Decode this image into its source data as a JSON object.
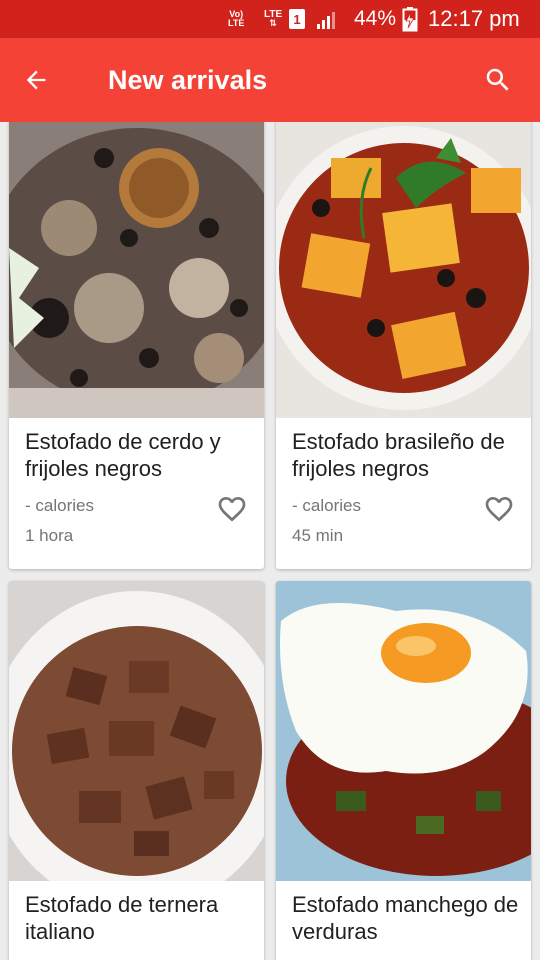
{
  "status_bar": {
    "volte_top": "Vo)",
    "volte_bottom": "LTE",
    "lte": "LTE",
    "sim": "1",
    "battery": "44%",
    "time": "12:17 pm"
  },
  "app_bar": {
    "title": "New arrivals",
    "back_icon": "arrow-back-icon",
    "search_icon": "search-icon"
  },
  "recipes": [
    {
      "name": "Estofado de cerdo y frijoles negros",
      "calories": "- calories",
      "time": "1 hora",
      "photo": "pork-black-beans-stew"
    },
    {
      "name": "Estofado brasileño de frijoles negros",
      "calories": "- calories",
      "time": "45 min",
      "photo": "squash-black-beans-stew"
    },
    {
      "name": "Estofado de ternera italiano",
      "calories": "",
      "time": "",
      "photo": "beef-stew"
    },
    {
      "name": "Estofado manchego de verduras",
      "calories": "",
      "time": "",
      "photo": "vegetable-stew-with-egg"
    }
  ],
  "colors": {
    "status_bar": "#d1221b",
    "app_bar": "#f44336",
    "background": "#ececec"
  }
}
